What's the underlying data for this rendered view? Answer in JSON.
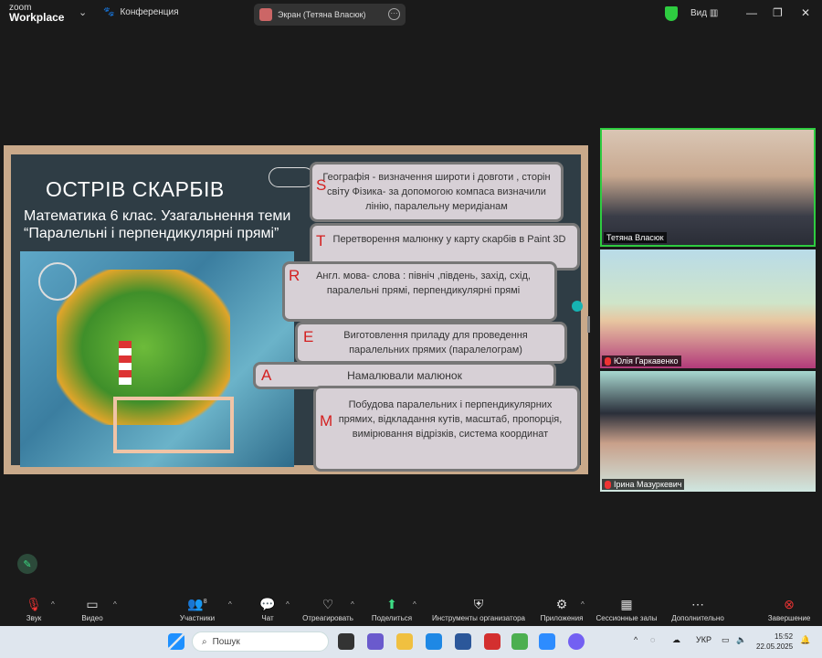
{
  "app": {
    "logo_line1": "zoom",
    "logo_line2": "Workplace",
    "meeting_label": "Конференция",
    "share_label": "Экран (Тетяна Власюк)",
    "view_label": "Вид"
  },
  "slide": {
    "title": "ОСТРІВ СКАРБІВ",
    "subtitle_line1": "Математика 6 клас. Узагальнення теми",
    "subtitle_line2": "“Паралельні і перпендикулярні прямі”",
    "cards": [
      {
        "letter": "S",
        "text": "Географія - визначення широти і довготи , сторін світу Фізика- за допомогою компаса визначили лінію, паралельну меридіанам"
      },
      {
        "letter": "T",
        "text": "Перетворення малюнку у карту скарбів в Paint 3D"
      },
      {
        "letter": "R",
        "text": "Англ. мова- слова : північ ,південь, захід, схід, паралельні прямі, перпендикулярні прямі"
      },
      {
        "letter": "E",
        "text": "Виготовлення приладу для проведення паралельних прямих (паралелограм)"
      },
      {
        "letter": "A",
        "text": "Намалювали малюнок"
      },
      {
        "letter": "M",
        "text": "Побудова паралельних і перпендикулярних прямих, відкладання кутів, масштаб, пропорція, вимірювання відрізків, система координат"
      }
    ]
  },
  "participants": [
    {
      "name": "Тетяна Власюк",
      "muted": false
    },
    {
      "name": "Юлія Гаркавенко",
      "muted": true
    },
    {
      "name": "Ірина Мазуркевич",
      "muted": true
    }
  ],
  "toolbar": [
    {
      "label": "Звук",
      "icon": "mic-off-icon"
    },
    {
      "label": "Видео",
      "icon": "video-icon"
    },
    {
      "label": "Участники",
      "icon": "participants-icon",
      "badge": "8"
    },
    {
      "label": "Чат",
      "icon": "chat-icon"
    },
    {
      "label": "Отреагировать",
      "icon": "heart-icon"
    },
    {
      "label": "Поделиться",
      "icon": "share-icon"
    },
    {
      "label": "Инструменты организатора",
      "icon": "shield-icon"
    },
    {
      "label": "Приложения",
      "icon": "apps-icon"
    },
    {
      "label": "Сессионные залы",
      "icon": "breakout-icon"
    },
    {
      "label": "Дополнительно",
      "icon": "more-icon"
    },
    {
      "label": "Завершение",
      "icon": "end-icon"
    }
  ],
  "taskbar": {
    "search_placeholder": "Пошук",
    "lang": "УКР",
    "time": "15:52",
    "date": "22.05.2025"
  },
  "colors": {
    "accent_green": "#2ecc40",
    "end_red": "#e33",
    "share_green": "#3ddc84"
  }
}
